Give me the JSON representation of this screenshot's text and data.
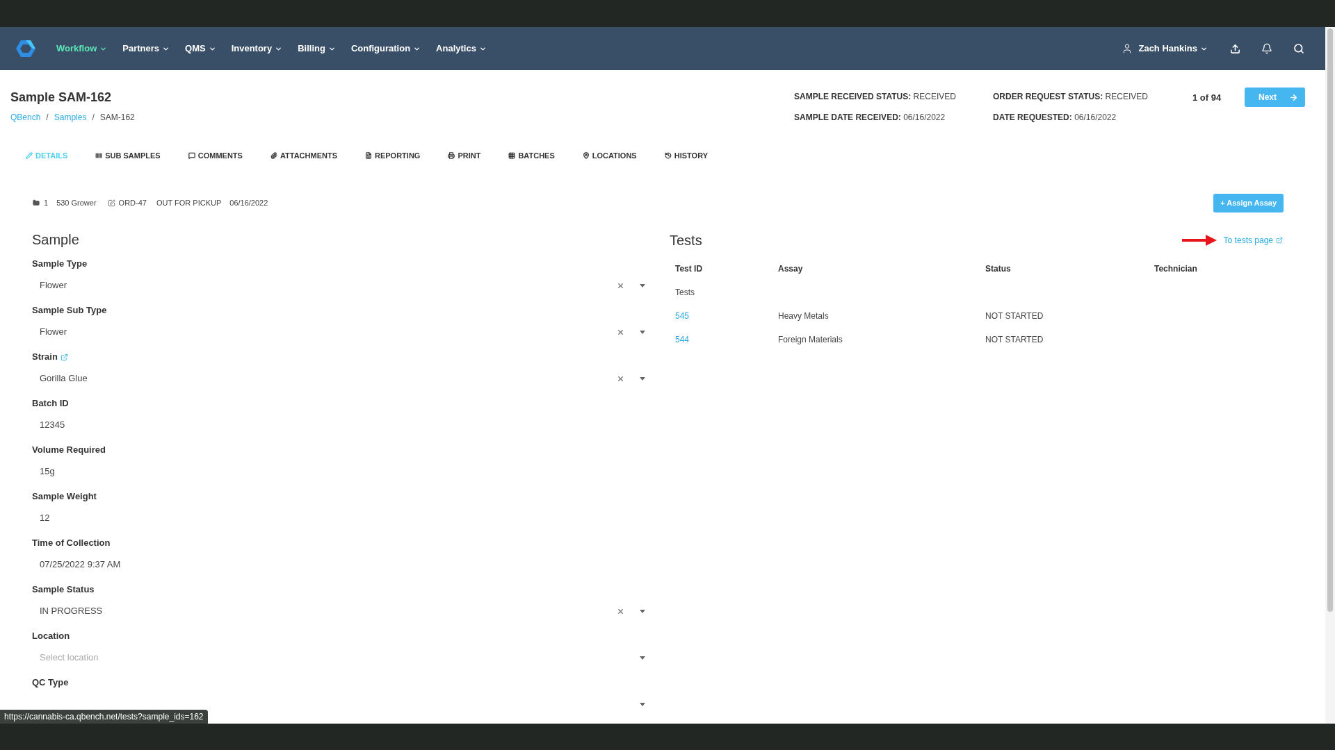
{
  "nav": {
    "items": [
      {
        "label": "Workflow",
        "selected": true
      },
      {
        "label": "Partners",
        "selected": false
      },
      {
        "label": "QMS",
        "selected": false
      },
      {
        "label": "Inventory",
        "selected": false
      },
      {
        "label": "Billing",
        "selected": false
      },
      {
        "label": "Configuration",
        "selected": false
      },
      {
        "label": "Analytics",
        "selected": false
      }
    ],
    "user": "Zach Hankins"
  },
  "title": "Sample SAM-162",
  "breadcrumb": [
    {
      "label": "QBench",
      "kind": "link"
    },
    {
      "label": "/",
      "kind": "separator"
    },
    {
      "label": "Samples",
      "kind": "link"
    },
    {
      "label": "/",
      "kind": "separator"
    },
    {
      "label": "SAM-162",
      "kind": "current"
    }
  ],
  "status": [
    {
      "label": "SAMPLE RECEIVED STATUS:",
      "value": "RECEIVED"
    },
    {
      "label": "SAMPLE DATE RECEIVED:",
      "value": "06/16/2022"
    },
    {
      "label": "ORDER REQUEST STATUS:",
      "value": "RECEIVED"
    },
    {
      "label": "DATE REQUESTED:",
      "value": "06/16/2022"
    }
  ],
  "pager": {
    "text": "1 of 94",
    "next": "Next"
  },
  "tabs": [
    {
      "label": "DETAILS",
      "selected": true
    },
    {
      "label": "SUB SAMPLES",
      "selected": false
    },
    {
      "label": "COMMENTS",
      "selected": false
    },
    {
      "label": "ATTACHMENTS",
      "selected": false
    },
    {
      "label": "REPORTING",
      "selected": false
    },
    {
      "label": "PRINT",
      "selected": false
    },
    {
      "label": "BATCHES",
      "selected": false
    },
    {
      "label": "LOCATIONS",
      "selected": false
    },
    {
      "label": "HISTORY",
      "selected": false
    }
  ],
  "info": {
    "count": "1",
    "customer": "530 Grower",
    "order": "ORD-47",
    "order_status": "OUT FOR PICKUP",
    "date": "06/16/2022"
  },
  "assign_button": "+ Assign Assay",
  "sample": {
    "heading": "Sample",
    "fields": [
      {
        "label": "Sample Type",
        "kind": "select",
        "value": "Flower"
      },
      {
        "label": "Sample Sub Type",
        "kind": "select",
        "value": "Flower"
      },
      {
        "label": "Strain",
        "kind": "select",
        "value": "Gorilla Glue",
        "link": true
      },
      {
        "label": "Batch ID",
        "kind": "text",
        "value": "12345"
      },
      {
        "label": "Volume Required",
        "kind": "text",
        "value": "15g"
      },
      {
        "label": "Sample Weight",
        "kind": "text",
        "value": "12"
      },
      {
        "label": "Time of Collection",
        "kind": "text",
        "value": "07/25/2022 9:37 AM"
      },
      {
        "label": "Sample Status",
        "kind": "select",
        "value": "IN PROGRESS"
      },
      {
        "label": "Location",
        "kind": "empty-select",
        "placeholder": "Select location"
      },
      {
        "label": "QC Type",
        "kind": "empty-select"
      }
    ]
  },
  "tests": {
    "heading": "Tests",
    "link": "To tests page",
    "columns": [
      "Test ID",
      "Assay",
      "Status",
      "Technician"
    ],
    "group": "Tests",
    "rows": [
      {
        "id": "545",
        "assay": "Heavy Metals",
        "status": "NOT STARTED"
      },
      {
        "id": "544",
        "assay": "Foreign Materials",
        "status": "NOT STARTED"
      }
    ]
  },
  "status_url": "https://cannabis-ca.qbench.net/tests?sample_ids=162"
}
